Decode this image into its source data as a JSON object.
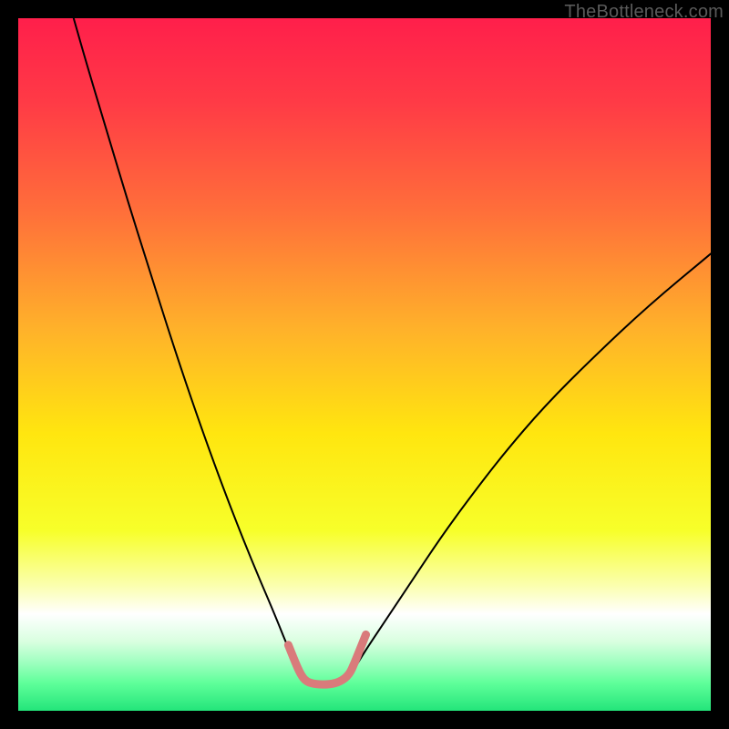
{
  "watermark": "TheBottleneck.com",
  "chart_data": {
    "type": "line",
    "title": "",
    "xlabel": "",
    "ylabel": "",
    "xlim": [
      0,
      100
    ],
    "ylim": [
      0,
      100
    ],
    "background_gradient": {
      "stops": [
        {
          "offset": 0.0,
          "color": "#ff1f4b"
        },
        {
          "offset": 0.12,
          "color": "#ff3a46"
        },
        {
          "offset": 0.28,
          "color": "#ff6f3a"
        },
        {
          "offset": 0.45,
          "color": "#ffb22a"
        },
        {
          "offset": 0.6,
          "color": "#ffe60f"
        },
        {
          "offset": 0.74,
          "color": "#f7ff2a"
        },
        {
          "offset": 0.82,
          "color": "#fbffb0"
        },
        {
          "offset": 0.86,
          "color": "#ffffff"
        },
        {
          "offset": 0.9,
          "color": "#d9ffe0"
        },
        {
          "offset": 0.93,
          "color": "#9fffc0"
        },
        {
          "offset": 0.96,
          "color": "#5fff9a"
        },
        {
          "offset": 1.0,
          "color": "#23e57a"
        }
      ]
    },
    "series": [
      {
        "name": "curve-left",
        "color": "#000000",
        "width": 2,
        "x": [
          8.0,
          10.0,
          13.0,
          16.0,
          19.0,
          22.0,
          25.0,
          28.0,
          31.0,
          34.0,
          37.0,
          39.0,
          40.5
        ],
        "y": [
          100.0,
          93.0,
          83.0,
          73.0,
          63.5,
          54.0,
          45.0,
          36.5,
          28.5,
          21.0,
          14.0,
          9.0,
          6.0
        ]
      },
      {
        "name": "curve-right",
        "color": "#000000",
        "width": 2,
        "x": [
          48.5,
          50.0,
          53.0,
          57.0,
          61.0,
          65.0,
          70.0,
          76.0,
          83.0,
          91.0,
          100.0
        ],
        "y": [
          6.0,
          8.5,
          13.0,
          19.0,
          25.0,
          30.5,
          37.0,
          44.0,
          51.0,
          58.5,
          66.0
        ]
      },
      {
        "name": "highlight-u",
        "color": "#d97b7b",
        "width": 9,
        "x": [
          39.0,
          40.0,
          40.8,
          41.6,
          43.0,
          45.0,
          46.5,
          47.8,
          48.6,
          49.4,
          50.2
        ],
        "y": [
          9.5,
          7.0,
          5.2,
          4.2,
          3.8,
          3.8,
          4.2,
          5.2,
          7.0,
          9.0,
          11.0
        ]
      }
    ]
  }
}
